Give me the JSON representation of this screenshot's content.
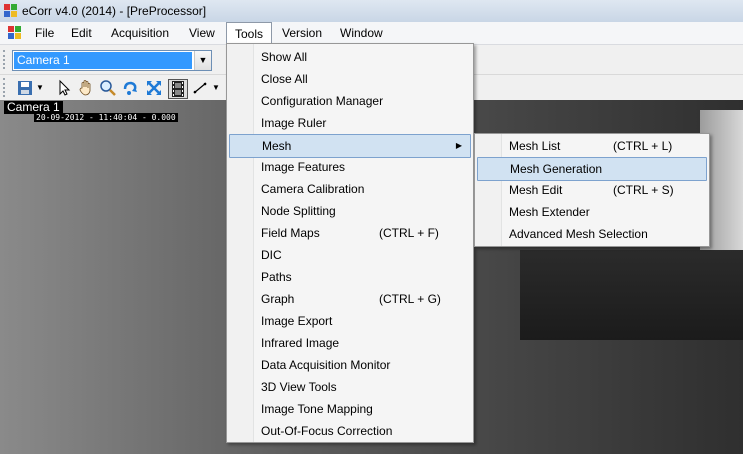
{
  "window": {
    "title": "eCorr v4.0 (2014) - [PreProcessor]"
  },
  "menubar": {
    "items": [
      "File",
      "Edit",
      "Acquisition",
      "View",
      "Tools",
      "Version",
      "Window"
    ]
  },
  "toolbar": {
    "camera_select": "Camera 1"
  },
  "viewer": {
    "camera_label": "Camera 1",
    "timestamp": "20-09-2012 - 11:40:04 - 0.000"
  },
  "tools_menu": {
    "items": [
      {
        "label": "Show All",
        "shortcut": ""
      },
      {
        "label": "Close All",
        "shortcut": ""
      },
      {
        "label": "Configuration Manager",
        "shortcut": ""
      },
      {
        "label": "Image Ruler",
        "shortcut": ""
      },
      {
        "label": "Mesh",
        "shortcut": "",
        "submenu": true
      },
      {
        "label": "Image Features",
        "shortcut": ""
      },
      {
        "label": "Camera Calibration",
        "shortcut": ""
      },
      {
        "label": "Node Splitting",
        "shortcut": ""
      },
      {
        "label": "Field Maps",
        "shortcut": "(CTRL + F)"
      },
      {
        "label": "DIC",
        "shortcut": ""
      },
      {
        "label": "Paths",
        "shortcut": ""
      },
      {
        "label": "Graph",
        "shortcut": "(CTRL + G)"
      },
      {
        "label": "Image Export",
        "shortcut": ""
      },
      {
        "label": "Infrared Image",
        "shortcut": ""
      },
      {
        "label": "Data Acquisition Monitor",
        "shortcut": ""
      },
      {
        "label": "3D View Tools",
        "shortcut": ""
      },
      {
        "label": "Image Tone Mapping",
        "shortcut": ""
      },
      {
        "label": "Out-Of-Focus Correction",
        "shortcut": ""
      }
    ]
  },
  "mesh_submenu": {
    "items": [
      {
        "label": "Mesh List",
        "shortcut": "(CTRL + L)"
      },
      {
        "label": "Mesh Generation",
        "shortcut": ""
      },
      {
        "label": "Mesh Edit",
        "shortcut": "(CTRL + S)"
      },
      {
        "label": "Mesh Extender",
        "shortcut": ""
      },
      {
        "label": "Advanced Mesh Selection",
        "shortcut": ""
      }
    ]
  }
}
